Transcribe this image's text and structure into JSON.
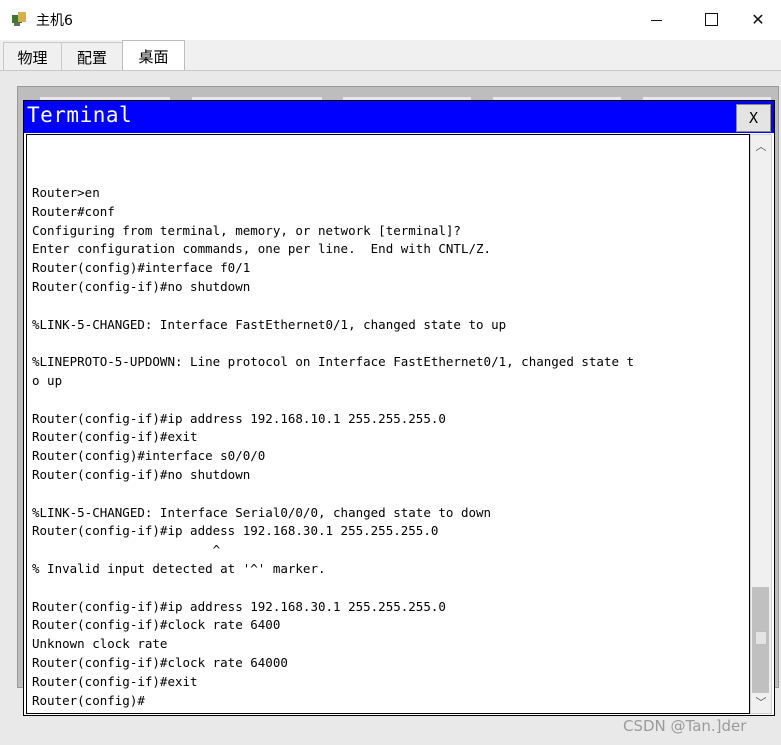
{
  "window": {
    "title": "主机6",
    "icon": "router-pc-icon"
  },
  "tabs": [
    {
      "label": "物理",
      "selected": false
    },
    {
      "label": "配置",
      "selected": false
    },
    {
      "label": "桌面",
      "selected": true
    }
  ],
  "terminal": {
    "title": "Terminal",
    "close_label": "X",
    "lines": [
      "Router>en",
      "Router#conf",
      "Configuring from terminal, memory, or network [terminal]?",
      "Enter configuration commands, one per line.  End with CNTL/Z.",
      "Router(config)#interface f0/1",
      "Router(config-if)#no shutdown",
      "",
      "%LINK-5-CHANGED: Interface FastEthernet0/1, changed state to up",
      "",
      "%LINEPROTO-5-UPDOWN: Line protocol on Interface FastEthernet0/1, changed state t",
      "o up",
      "",
      "Router(config-if)#ip address 192.168.10.1 255.255.255.0",
      "Router(config-if)#exit",
      "Router(config)#interface s0/0/0",
      "Router(config-if)#no shutdown",
      "",
      "%LINK-5-CHANGED: Interface Serial0/0/0, changed state to down",
      "Router(config-if)#ip addess 192.168.30.1 255.255.255.0",
      "                        ^",
      "% Invalid input detected at '^' marker.",
      "",
      "Router(config-if)#ip address 192.168.30.1 255.255.255.0",
      "Router(config-if)#clock rate 6400",
      "Unknown clock rate",
      "Router(config-if)#clock rate 64000",
      "Router(config-if)#exit",
      "Router(config)#"
    ]
  },
  "watermark": "CSDN @Tan.]der"
}
